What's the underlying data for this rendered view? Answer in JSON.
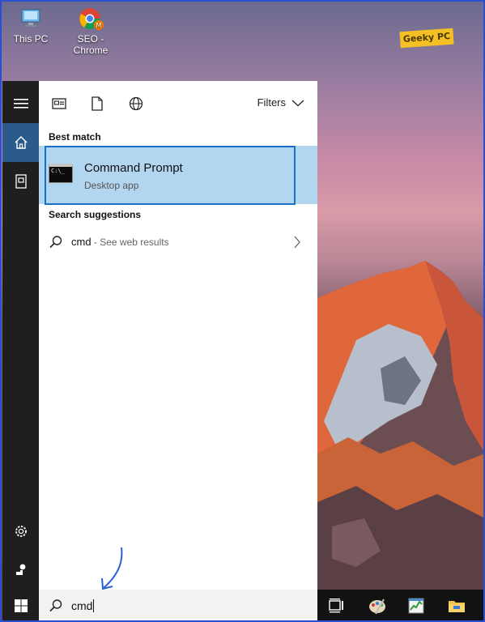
{
  "desktop": {
    "icons": [
      {
        "label_line1": "This PC",
        "label_line2": ""
      },
      {
        "label_line1": "SEO -",
        "label_line2": "Chrome"
      }
    ],
    "watermark": "Geeky PC"
  },
  "start_menu": {
    "filters_label": "Filters",
    "best_match_label": "Best match",
    "best_match": {
      "title": "Command Prompt",
      "subtitle": "Desktop app",
      "icon_text": "C:\\_"
    },
    "suggestions_label": "Search suggestions",
    "suggestion": {
      "query": "cmd",
      "hint": " - See web results"
    }
  },
  "search": {
    "value": "cmd"
  },
  "colors": {
    "accent": "#2b5b8a",
    "highlight": "#b3d6f0",
    "outline": "#1a6fc7"
  }
}
